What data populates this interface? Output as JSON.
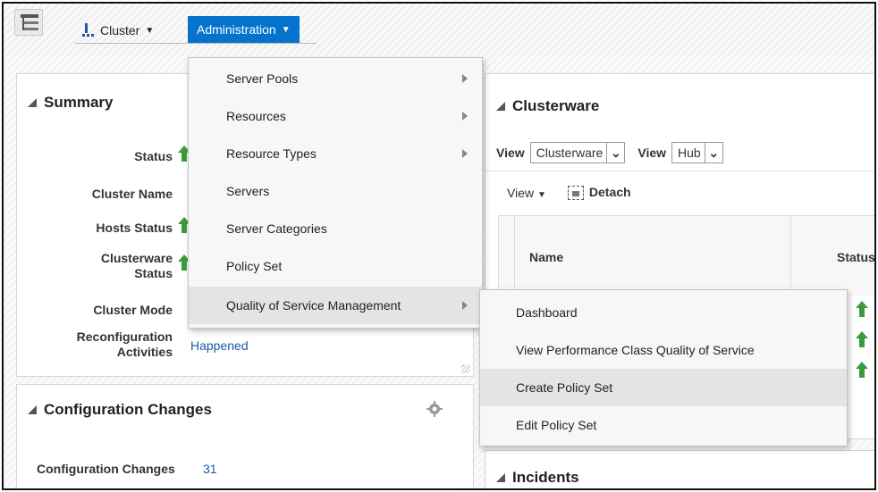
{
  "toolbar": {
    "cluster_label": "Cluster",
    "admin_label": "Administration"
  },
  "summary": {
    "title": "Summary",
    "rows": [
      {
        "label": "Status"
      },
      {
        "label": "Cluster Name"
      },
      {
        "label": "Hosts Status"
      },
      {
        "label": "Clusterware Status"
      },
      {
        "label": "Cluster Mode"
      },
      {
        "label": "Reconfiguration Activities",
        "value": "Happened"
      }
    ]
  },
  "config": {
    "title": "Configuration Changes",
    "label": "Configuration Changes",
    "value": "31"
  },
  "clusterware": {
    "title": "Clusterware",
    "view1_label": "View",
    "view1_value": "Clusterware",
    "view2_label": "View",
    "view2_value": "Hub",
    "view_menu": "View",
    "detach": "Detach",
    "col_name": "Name",
    "col_status": "Status"
  },
  "incidents": {
    "title": "Incidents"
  },
  "admin_menu": {
    "items": [
      {
        "label": "Server Pools",
        "submenu": true
      },
      {
        "label": "Resources",
        "submenu": true
      },
      {
        "label": "Resource Types",
        "submenu": true
      },
      {
        "label": "Servers",
        "submenu": false
      },
      {
        "label": "Server Categories",
        "submenu": false
      },
      {
        "label": "Policy Set",
        "submenu": false
      },
      {
        "label": "Quality of Service Management",
        "submenu": true,
        "highlighted": true
      }
    ]
  },
  "qos_submenu": {
    "items": [
      {
        "label": "Dashboard"
      },
      {
        "label": "View Performance Class Quality of Service"
      },
      {
        "label": "Create Policy Set",
        "highlighted": true
      },
      {
        "label": "Edit Policy Set"
      }
    ]
  },
  "colors": {
    "accent": "#0572ce",
    "link": "#1a5aa6",
    "status_up": "#3c9a3c"
  }
}
